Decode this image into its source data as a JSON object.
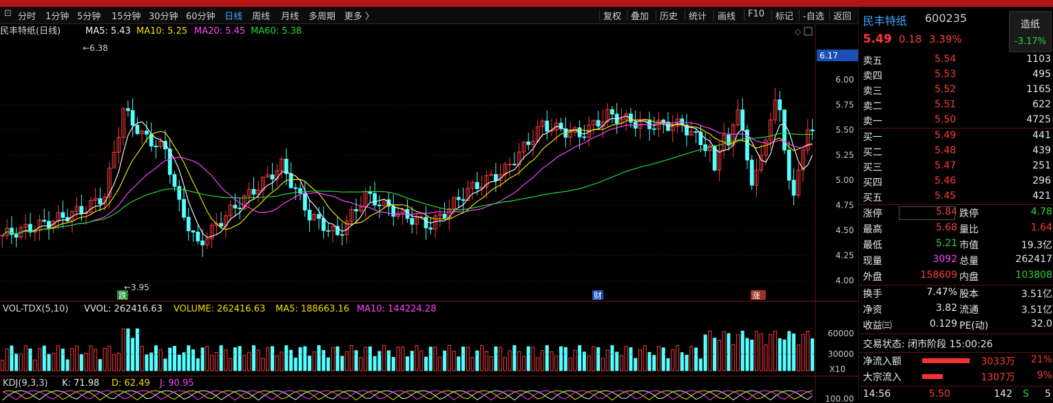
{
  "toolbar": {
    "periods": [
      "分时",
      "1分钟",
      "5分钟",
      "15分钟",
      "30分钟",
      "60分钟",
      "日线",
      "周线",
      "月线",
      "多周期",
      "更多 〉"
    ],
    "active_period": "日线",
    "buttons": [
      "复权",
      "叠加",
      "历史",
      "统计",
      "画线",
      "F10",
      "标记",
      "-自选",
      "返回"
    ]
  },
  "chart": {
    "title": "民丰特纸(日线)",
    "ma_labels": [
      {
        "text": "MA5: 5.43",
        "color": "#f0f0f0"
      },
      {
        "text": "MA10: 5.25",
        "color": "#f0e000"
      },
      {
        "text": "MA20: 5.45",
        "color": "#ff44ff"
      },
      {
        "text": "MA60: 5.38",
        "color": "#22d840"
      }
    ],
    "yaxis_ticks": [
      "6.00",
      "5.75",
      "5.50",
      "5.25",
      "5.00",
      "4.75",
      "4.50",
      "4.25",
      "4.00"
    ],
    "current_price_tag": "6.17",
    "high_annotation": "6.38",
    "low_annotation": "3.95",
    "event_markers": [
      "跌",
      "财",
      "涨"
    ],
    "volume_header": {
      "name": "VOL-TDX(5,10)",
      "vvol": "VVOL: 262416.63",
      "volume": "VOLUME: 262416.63",
      "ma5": "MA5: 188663.16",
      "ma10": "MA10: 144224.28"
    },
    "volume_ticks": [
      "60000",
      "30000"
    ],
    "volume_unit": "X10",
    "kdj_header": {
      "name": "KDJ(9,3,3)",
      "k": "K: 71.98",
      "d": "D: 62.49",
      "j": "J: 90.95"
    },
    "kdj_tick": "100.00",
    "colors": {
      "up": "#ff3b3b",
      "down": "#54ffff",
      "ma5": "#f0f0f0",
      "ma10": "#f0e000",
      "ma20": "#ff44ff",
      "ma60": "#22d840"
    }
  },
  "quote": {
    "name": "民丰特纸",
    "code": "600235",
    "price": "5.49",
    "change": "0.18",
    "change_pct": "3.39%",
    "sector_name": "造纸",
    "sector_pct": "-3.17%",
    "asks": [
      {
        "label": "卖五",
        "price": "5.54",
        "vol": "1103"
      },
      {
        "label": "卖四",
        "price": "5.53",
        "vol": "495"
      },
      {
        "label": "卖三",
        "price": "5.52",
        "vol": "1165"
      },
      {
        "label": "卖二",
        "price": "5.51",
        "vol": "622"
      },
      {
        "label": "卖一",
        "price": "5.50",
        "vol": "4725"
      }
    ],
    "bids": [
      {
        "label": "买一",
        "price": "5.49",
        "vol": "441"
      },
      {
        "label": "买二",
        "price": "5.48",
        "vol": "439"
      },
      {
        "label": "买三",
        "price": "5.47",
        "vol": "251"
      },
      {
        "label": "买四",
        "price": "5.46",
        "vol": "296"
      },
      {
        "label": "买五",
        "price": "5.45",
        "vol": "421"
      }
    ],
    "stats": [
      {
        "l1": "涨停",
        "v1": "5.84",
        "c1": "red",
        "l2": "跌停",
        "v2": "4.78",
        "c2": "green"
      },
      {
        "l1": "最高",
        "v1": "5.68",
        "c1": "red",
        "l2": "量比",
        "v2": "1.64",
        "c2": "red"
      },
      {
        "l1": "最低",
        "v1": "5.21",
        "c1": "green",
        "l2": "市值",
        "v2": "19.3亿",
        "c2": "white"
      },
      {
        "l1": "现量",
        "v1": "3092",
        "c1": "magenta",
        "l2": "总量",
        "v2": "262417",
        "c2": "white"
      },
      {
        "l1": "外盘",
        "v1": "158609",
        "c1": "red",
        "l2": "内盘",
        "v2": "103808",
        "c2": "green"
      }
    ],
    "stats2": [
      {
        "l1": "换手",
        "v1": "7.47%",
        "l2": "股本",
        "v2": "3.51亿"
      },
      {
        "l1": "净资",
        "v1": "3.82",
        "l2": "流通",
        "v2": "3.51亿"
      },
      {
        "l1": "收益㈢",
        "v1": "0.129",
        "l2": "PE(动)",
        "v2": "32.0"
      }
    ],
    "trade_status": "交易状态: 闭市阶段 15:00:26",
    "flows": [
      {
        "label": "净流入额",
        "amount": "3033万",
        "pct": "21%",
        "bar": 0.21
      },
      {
        "label": "大宗流入",
        "amount": "1307万",
        "pct": "9%",
        "bar": 0.09
      }
    ],
    "tick": {
      "time": "14:56",
      "price": "5.50",
      "vol": "142",
      "side": "S",
      "extra": "5"
    }
  }
}
